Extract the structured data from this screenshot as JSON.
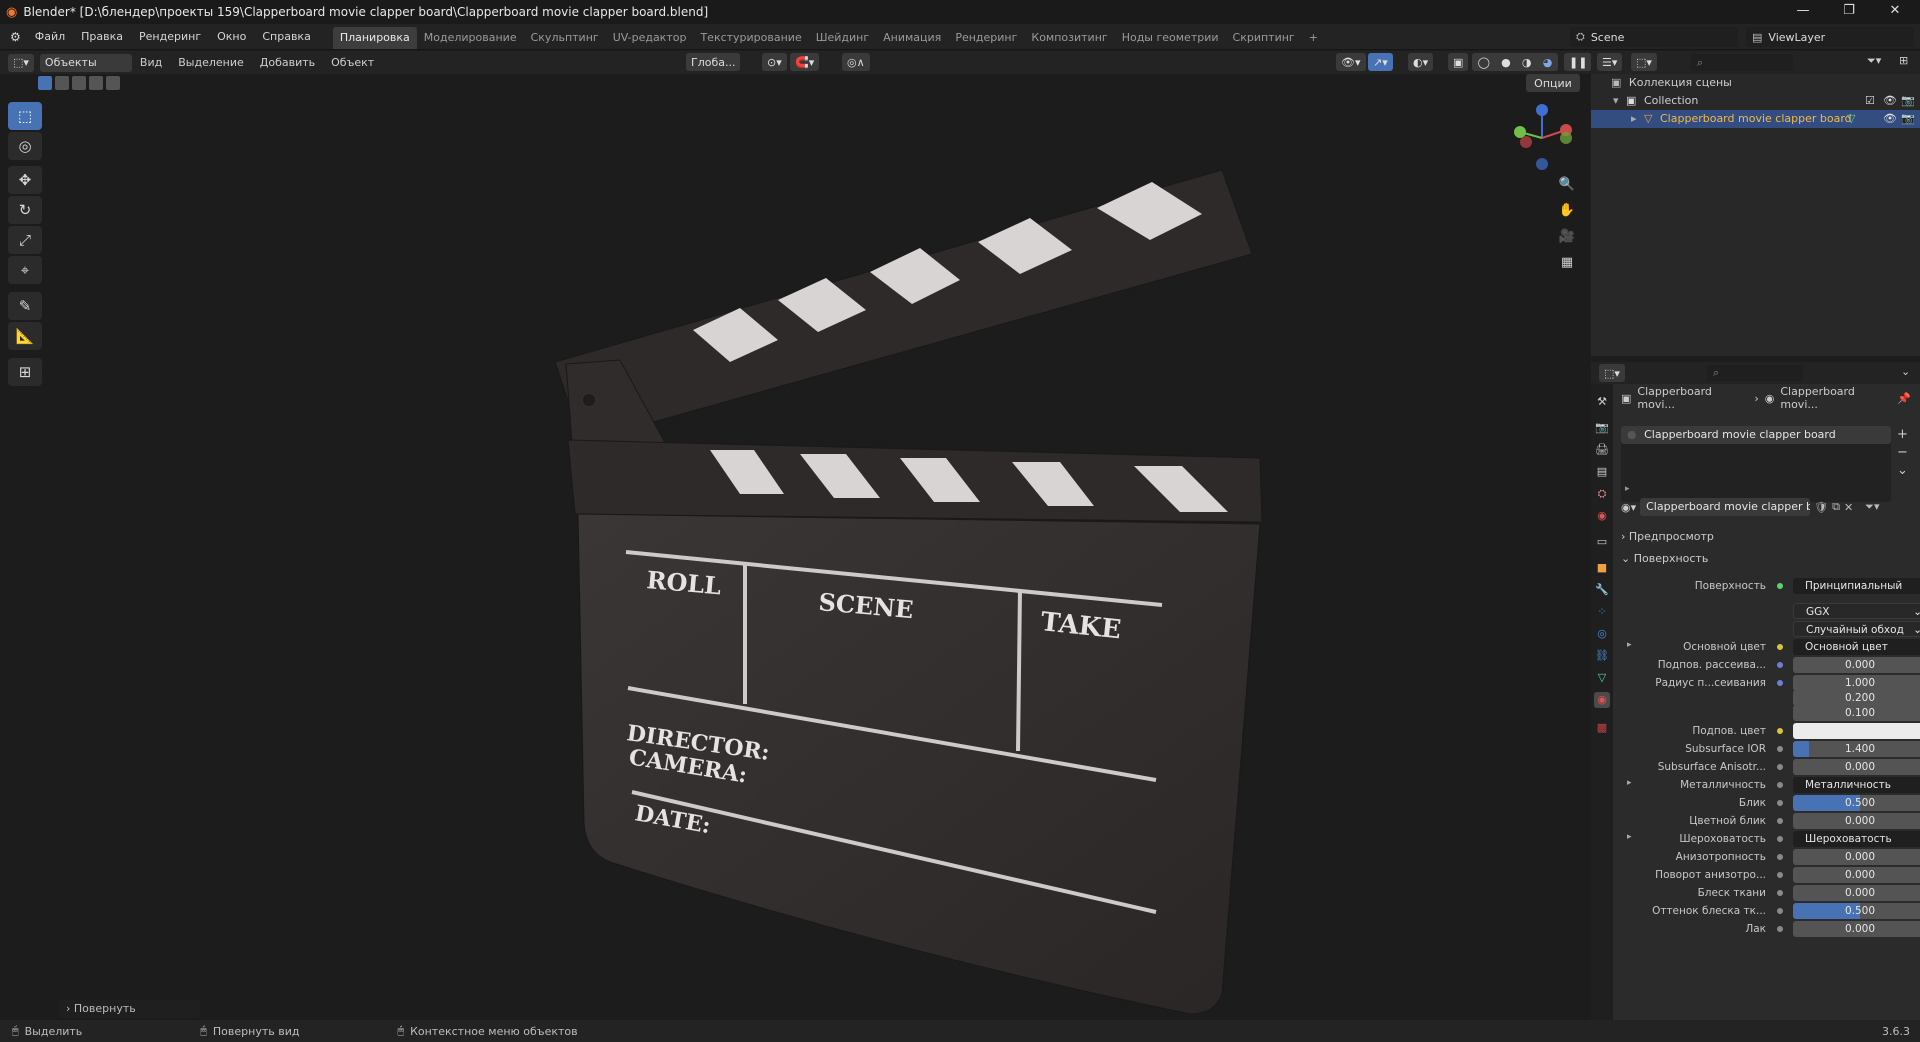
{
  "window": {
    "title": "Blender* [D:\\блендер\\проекты 159\\Clapperboard movie clapper board\\Clapperboard movie clapper board.blend]",
    "min": "—",
    "max": "❐",
    "close": "✕"
  },
  "menu": [
    "Файл",
    "Правка",
    "Рендеринг",
    "Окно",
    "Справка"
  ],
  "workspaces": [
    "Планировка",
    "Моделирование",
    "Скульптинг",
    "UV-редактор",
    "Текстурирование",
    "Шейдинг",
    "Анимация",
    "Рендеринг",
    "Композитинг",
    "Ноды геометрии",
    "Скриптинг",
    "+"
  ],
  "active_workspace": "Планировка",
  "scene_name": "Scene",
  "view_layer": "ViewLayer",
  "viewport_header": {
    "mode": "Объекты",
    "items": [
      "Вид",
      "Выделение",
      "Добавить",
      "Объект"
    ],
    "transform_orientation": "Глоба...",
    "options": "Опции"
  },
  "tools": [
    "select",
    "cursor",
    "move",
    "rotate",
    "scale",
    "transform",
    "annotate",
    "measure",
    "add-cube"
  ],
  "last_operator": "Повернуть",
  "clapperboard": {
    "roll": "ROLL",
    "scene": "SCENE",
    "take": "TAKE",
    "director": "DIRECTOR:",
    "camera": "CAMERA:",
    "date": "DATE:"
  },
  "outliner": {
    "scene_collection": "Коллекция сцены",
    "collection": "Collection",
    "object": "Clapperboard movie clapper board"
  },
  "properties": {
    "breadcrumb_1": "Clapperboard movi...",
    "breadcrumb_2": "Clapperboard movi...",
    "material_slot": "Clapperboard movie clapper board",
    "material_name": "Clapperboard movie clapper board",
    "preview_label": "Предпросмотр",
    "surface_panel": "Поверхность",
    "rows": [
      {
        "label": "Поверхность",
        "value": "Принципиальный BSDF",
        "kind": "dark",
        "dot": "#5bd36b"
      },
      {
        "label": "",
        "value": "GGX",
        "kind": "dropdown"
      },
      {
        "label": "",
        "value": "Случайный обход",
        "kind": "dropdown"
      },
      {
        "label": "Основной цвет",
        "value": "Основной цвет",
        "kind": "dark",
        "dot": "#d8c53a",
        "expand": true
      },
      {
        "label": "Подпов. рассеива...",
        "value": "0.000",
        "kind": "num",
        "dot": "#6b7fd6"
      },
      {
        "label": "Радиус п...сеивания",
        "value": "1.000",
        "kind": "num",
        "dot": "#6b7fd6"
      },
      {
        "label": "",
        "value": "0.200",
        "kind": "num"
      },
      {
        "label": "",
        "value": "0.100",
        "kind": "num"
      },
      {
        "label": "Подпов. цвет",
        "value": "",
        "kind": "white",
        "dot": "#d8c53a"
      },
      {
        "label": "Subsurface IOR",
        "value": "1.400",
        "kind": "blue",
        "pct": "12%",
        "dot": "#8a8a8a"
      },
      {
        "label": "Subsurface Anisotr...",
        "value": "0.000",
        "kind": "num",
        "dot": "#8a8a8a"
      },
      {
        "label": "Металличность",
        "value": "Металличность",
        "kind": "dark",
        "dot": "#8a8a8a",
        "expand": true
      },
      {
        "label": "Блик",
        "value": "0.500",
        "kind": "blue",
        "pct": "50%",
        "dot": "#8a8a8a"
      },
      {
        "label": "Цветной блик",
        "value": "0.000",
        "kind": "num",
        "dot": "#8a8a8a"
      },
      {
        "label": "Шероховатость",
        "value": "Шероховатость",
        "kind": "dark",
        "dot": "#8a8a8a",
        "expand": true
      },
      {
        "label": "Анизотропность",
        "value": "0.000",
        "kind": "num",
        "dot": "#8a8a8a"
      },
      {
        "label": "Поворот анизотро...",
        "value": "0.000",
        "kind": "num",
        "dot": "#8a8a8a"
      },
      {
        "label": "Блеск ткани",
        "value": "0.000",
        "kind": "num",
        "dot": "#8a8a8a"
      },
      {
        "label": "Оттенок блеска тк...",
        "value": "0.500",
        "kind": "blue",
        "pct": "50%",
        "dot": "#8a8a8a"
      },
      {
        "label": "Лак",
        "value": "0.000",
        "kind": "num",
        "dot": "#8a8a8a"
      }
    ]
  },
  "status": {
    "select": "Выделить",
    "rotate_view": "Повернуть вид",
    "context_menu": "Контекстное меню объектов",
    "version": "3.6.3"
  }
}
